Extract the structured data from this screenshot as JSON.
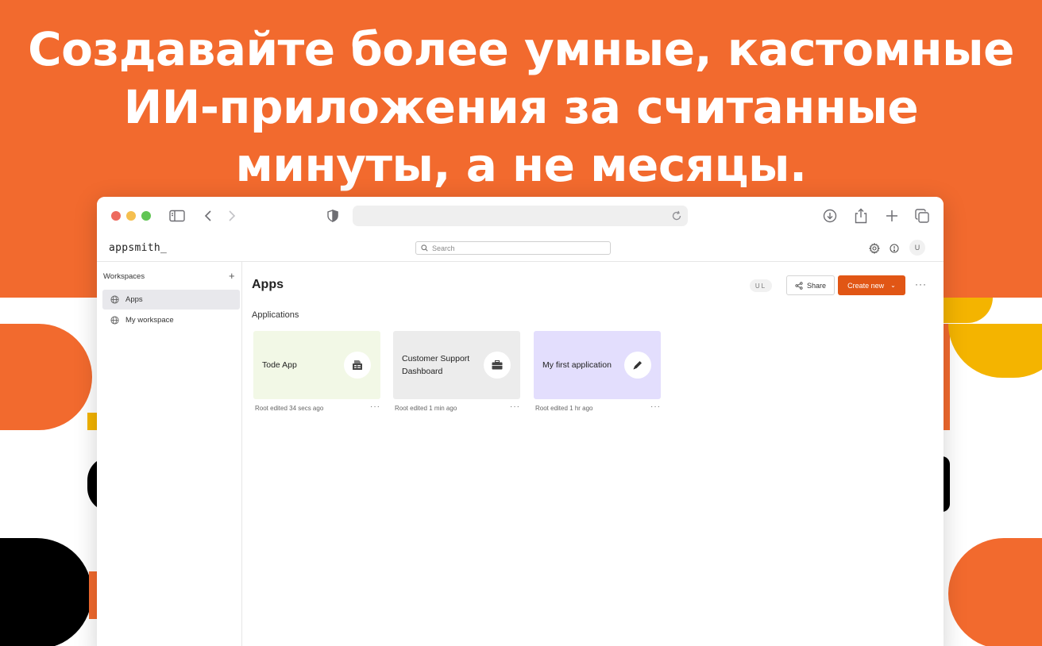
{
  "headline": {
    "line1": "Создавайте более умные, кастомные",
    "line2": "ИИ-приложения за считанные",
    "line3": "минуты, а не месяцы."
  },
  "app": {
    "logo": "appsmith_",
    "search_placeholder": "Search",
    "avatar_initial": "U"
  },
  "sidebar": {
    "title": "Workspaces",
    "add_symbol": "+",
    "items": [
      {
        "label": "Apps",
        "active": true
      },
      {
        "label": "My workspace",
        "active": false
      }
    ]
  },
  "main": {
    "title": "Apps",
    "user_chip": "UL",
    "share_label": "Share",
    "create_label": "Create new",
    "more_symbol": "···",
    "section_title": "Applications",
    "cards": [
      {
        "name": "Tode App",
        "meta": "Root edited 34 secs ago",
        "icon": "form-icon",
        "color": "#f2f8e6"
      },
      {
        "name": "Customer Support Dashboard",
        "meta": "Root edited 1 min ago",
        "icon": "briefcase-icon",
        "color": "#ececec"
      },
      {
        "name": "My first application",
        "meta": "Root edited 1 hr ago",
        "icon": "pencil-icon",
        "color": "#e3defd"
      }
    ]
  },
  "colors": {
    "brand_orange": "#f26a2e",
    "accent_yellow": "#f4b400",
    "button_orange": "#e15615"
  }
}
